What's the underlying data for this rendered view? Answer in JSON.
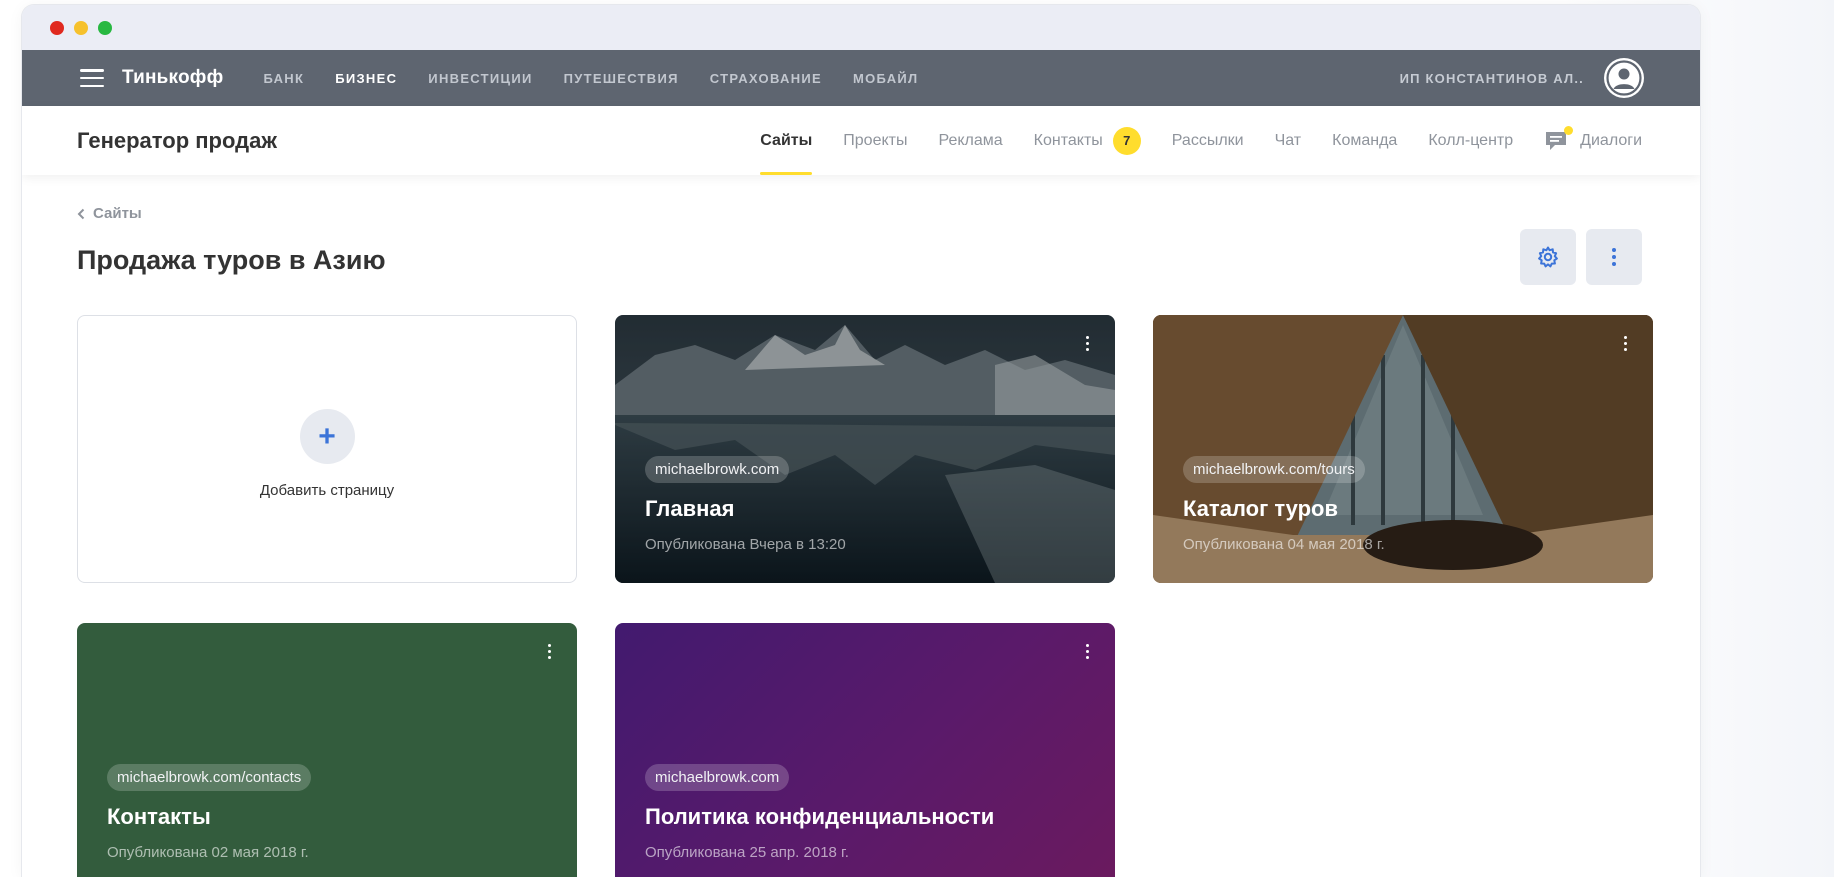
{
  "window": {
    "dots": [
      "#e0291f",
      "#f6c12c",
      "#28b841"
    ]
  },
  "topnav": {
    "brand": "Тинькофф",
    "links": [
      {
        "label": "БАНК",
        "active": false
      },
      {
        "label": "БИЗНЕС",
        "active": true
      },
      {
        "label": "ИНВЕСТИЦИИ",
        "active": false
      },
      {
        "label": "ПУТЕШЕСТВИЯ",
        "active": false
      },
      {
        "label": "СТРАХОВАНИЕ",
        "active": false
      },
      {
        "label": "МОБАЙЛ",
        "active": false
      }
    ],
    "user_name": "ИП КОНСТАНТИНОВ АЛ..",
    "avatar_icon": "user-avatar-icon"
  },
  "subheader": {
    "product_name": "Генератор продаж",
    "tabs": [
      {
        "label": "Сайты",
        "active": true
      },
      {
        "label": "Проекты",
        "active": false
      },
      {
        "label": "Реклама",
        "active": false
      },
      {
        "label": "Контакты",
        "active": false,
        "badge": "7"
      },
      {
        "label": "Рассылки",
        "active": false
      },
      {
        "label": "Чат",
        "active": false
      },
      {
        "label": "Команда",
        "active": false
      },
      {
        "label": "Колл-центр",
        "active": false
      }
    ],
    "dialogs_label": "Диалоги"
  },
  "page": {
    "breadcrumb": "Сайты",
    "title": "Продажа туров в Азию"
  },
  "add_card": {
    "plus": "+",
    "label": "Добавить страницу"
  },
  "cards": [
    {
      "url": "michaelbrowk.com",
      "title": "Главная",
      "date": "Опубликована Вчера в 13:20",
      "bg": "lake"
    },
    {
      "url": "michaelbrowk.com/tours",
      "title": "Каталог туров",
      "date": "Опубликована 04 мая 2018 г.",
      "bg": "tent"
    },
    {
      "url": "michaelbrowk.com/contacts",
      "title": "Контакты",
      "date": "Опубликована 02 мая 2018 г.",
      "bg": "#335c3d"
    },
    {
      "url": "michaelbrowk.com",
      "title": "Политика конфиденциальности",
      "date": "Опубликована 25 апр. 2018 г.",
      "bg": "purple"
    }
  ],
  "colors": {
    "accent_yellow": "#ffdd2d",
    "topnav_bg": "#5e6570",
    "icon_blue": "#3c74d8"
  }
}
